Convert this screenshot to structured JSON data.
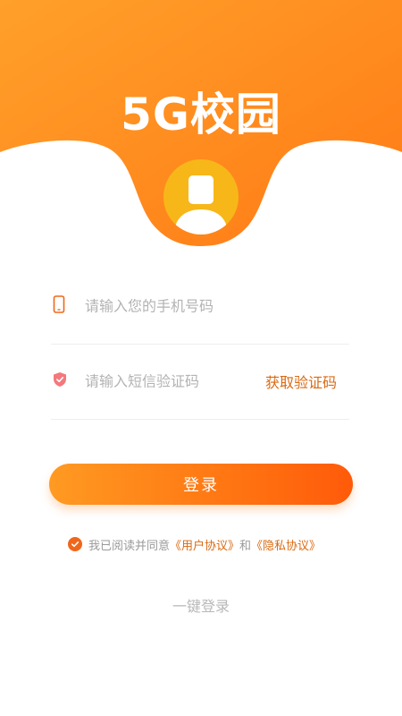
{
  "header": {
    "logo_text": "5G校园",
    "bg_color_start": "#ffa02a",
    "bg_color_end": "#ff7a15"
  },
  "form": {
    "phone_placeholder": "请输入您的手机号码",
    "phone_value": "",
    "code_placeholder": "请输入短信验证码",
    "code_value": "",
    "get_code_label": "获取验证码"
  },
  "login_button": {
    "label": "登录",
    "accent": "#ff7512"
  },
  "agreement": {
    "checked": true,
    "prefix": "我已阅读并同意",
    "user_agreement": "《用户协议》",
    "connector": "和",
    "privacy_agreement": "《隐私协议》"
  },
  "quick_login": {
    "label": "一键登录"
  },
  "icons": [
    "phone-icon",
    "shield-icon",
    "check-icon",
    "user-avatar-icon"
  ]
}
